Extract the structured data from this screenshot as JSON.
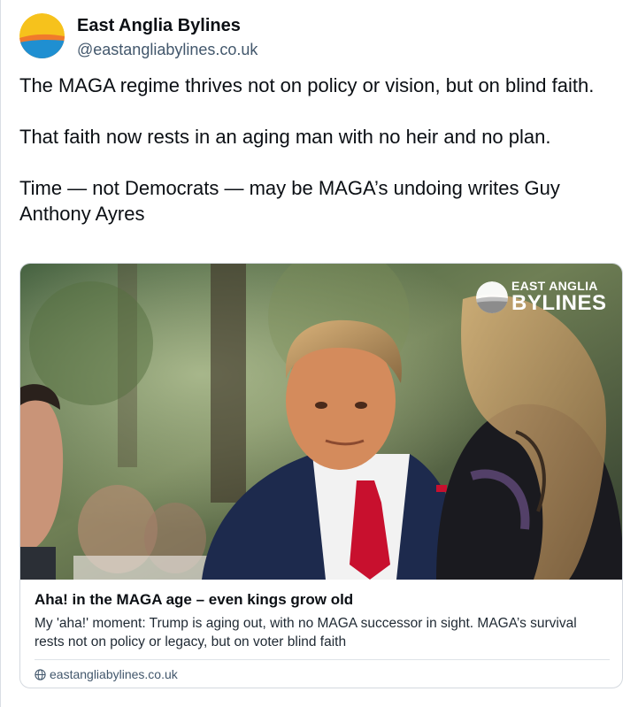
{
  "author": {
    "display_name": "East Anglia Bylines",
    "handle": "@eastangliabylines.co.uk",
    "avatar_icon": "sunrise-logo-icon"
  },
  "post": {
    "text": "The MAGA regime thrives not on policy or vision, but on blind faith.\n\nThat faith now rests in an aging man with no heir and no plan.\n\nTime — not Democrats — may be MAGA’s undoing writes Guy Anthony Ayres"
  },
  "card": {
    "image_watermark_line1": "EAST ANGLIA",
    "image_watermark_line2": "BYLINES",
    "title": "Aha! in the MAGA age – even kings grow old",
    "description": "My 'aha!' moment: Trump is aging out, with no MAGA successor in sight. MAGA’s survival rests not on policy or legacy, but on voter blind faith",
    "domain": "eastangliabylines.co.uk",
    "domain_icon": "globe-icon"
  },
  "colors": {
    "logo_yellow": "#f6c21c",
    "logo_orange": "#f07a2b",
    "logo_blue": "#1f8fd1",
    "suit_navy": "#1d2a4d",
    "tie_red": "#c8102e"
  }
}
